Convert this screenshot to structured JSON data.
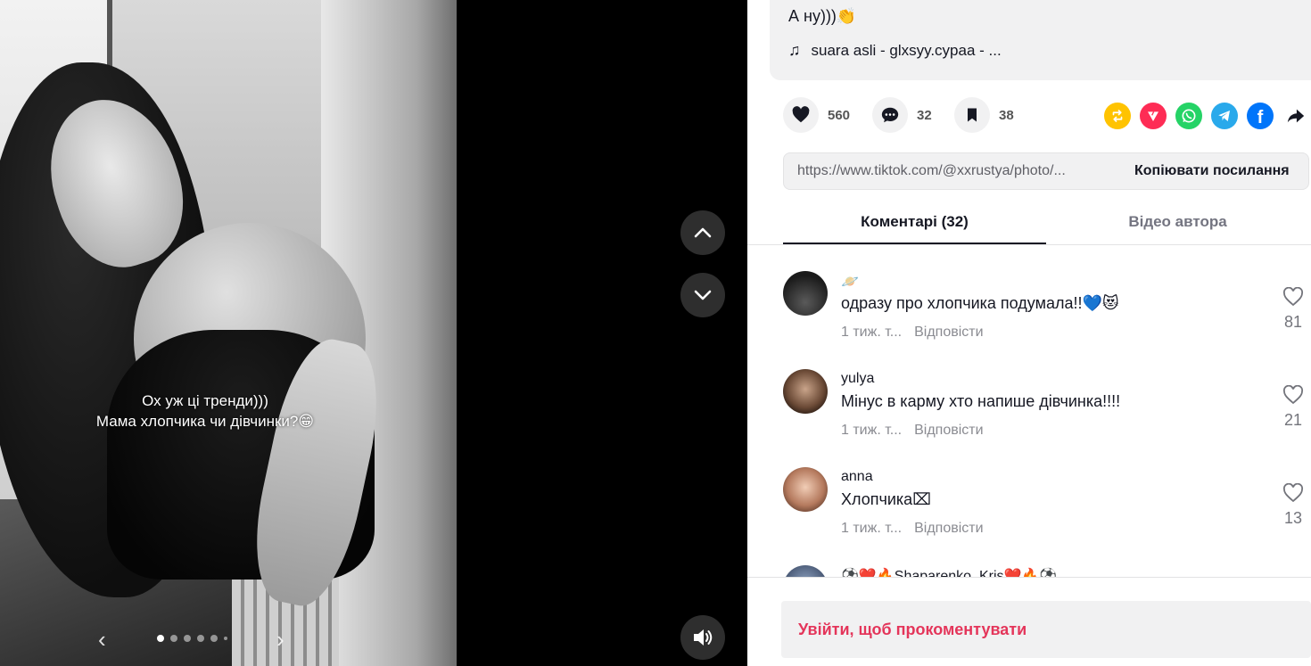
{
  "post": {
    "caption_line1": "Ох уж ці тренди)))",
    "caption_line2": "Мама хлопчика чи дівчинки?😁",
    "slides_total": 6,
    "slide_active": 1
  },
  "description": {
    "text": "А ну)))👏",
    "music": "suara asli - glxsyy.cypaa - ..."
  },
  "stats": {
    "likes": "560",
    "comments": "32",
    "saves": "38"
  },
  "share_icons": [
    "repost-icon",
    "send-icon",
    "whatsapp-icon",
    "telegram-icon",
    "facebook-icon",
    "share-arrow-icon"
  ],
  "share_colors": {
    "repost": "#ffc300",
    "send": "#fe2c55",
    "whatsapp": "#25d366",
    "telegram": "#29a9eb",
    "facebook": "#0075fa"
  },
  "link": {
    "url": "https://www.tiktok.com/@xxrustya/photo/...",
    "copy_label": "Копіювати посилання"
  },
  "tabs": {
    "comments": "Коментарі (32)",
    "author_videos": "Відео автора"
  },
  "comments": [
    {
      "user": "🪐",
      "text": "одразу про хлопчика подумала!!💙😻",
      "time": "1 тиж. т...",
      "reply": "Відповісти",
      "likes": "81"
    },
    {
      "user": "yulya",
      "text": "Мінус в карму хто напише дівчинка!!!!",
      "time": "1 тиж. т...",
      "reply": "Відповісти",
      "likes": "21"
    },
    {
      "user": "anna",
      "text": "Хлопчика⌧",
      "time": "1 тиж. т...",
      "reply": "Відповісти",
      "likes": "13"
    },
    {
      "user": "⚽❤️🔥Shaparenko_Kris❤️🔥⚽"
    }
  ],
  "login_label": "Увійти, щоб прокоментувати",
  "colors": {
    "accent": "#fe2c55",
    "login_text": "#e4355a",
    "panel_bg": "#f1f1f2"
  }
}
